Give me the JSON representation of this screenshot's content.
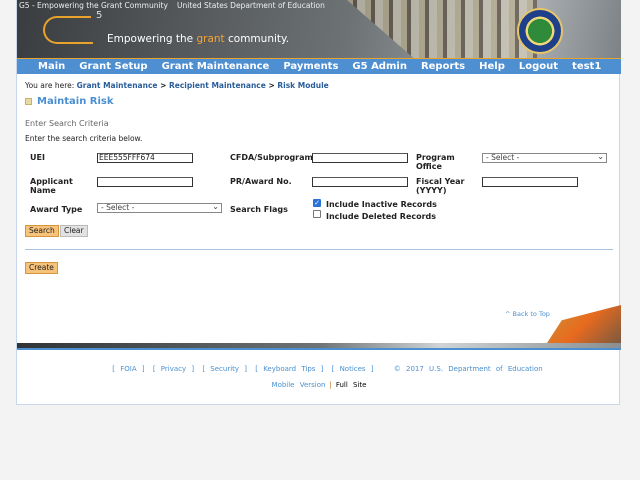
{
  "header": {
    "logo_alt": "G5 - Empowering the Grant Community",
    "seal_alt": "United States Department of Education",
    "logo_mark": "G5",
    "tagline_pre": "Empowering the ",
    "tagline_grant": "grant",
    "tagline_post": " community.",
    "accent": "#e8a32c"
  },
  "nav": {
    "items": [
      "Main",
      "Grant Setup",
      "Grant Maintenance",
      "Payments",
      "G5 Admin",
      "Reports",
      "Help",
      "Logout",
      "test1"
    ],
    "color": "#4e8fd2"
  },
  "breadcrumb": {
    "prefix": "You are here: ",
    "items": [
      "Grant Maintenance",
      "Recipient Maintenance",
      "Risk Module"
    ],
    "sep": " > "
  },
  "page_title": "Maintain Risk",
  "section": "Enter Search Criteria",
  "instructions": "Enter the search criteria below.",
  "form": {
    "uei": {
      "label": "UEI",
      "value": "EEE555FFF674"
    },
    "cfda": {
      "label": "CFDA/Subprogram",
      "value": ""
    },
    "program_office": {
      "label_1": "Program",
      "label_2": "Office",
      "value": "- Select -"
    },
    "applicant": {
      "label_1": "Applicant",
      "label_2": "Name",
      "value": ""
    },
    "pr_award": {
      "label": "PR/Award No.",
      "value": ""
    },
    "fiscal_year": {
      "label_1": "Fiscal Year",
      "label_2": "(YYYY)",
      "value": ""
    },
    "award_type": {
      "label": "Award Type",
      "value": "- Select -"
    },
    "search_flags": {
      "label": "Search Flags",
      "inactive": {
        "label": "Include Inactive Records",
        "checked": true
      },
      "deleted": {
        "label": "Include Deleted Records",
        "checked": false
      }
    }
  },
  "buttons": {
    "search": "Search",
    "clear": "Clear",
    "create": "Create"
  },
  "back_to_top": "^ Back to Top",
  "footer": {
    "links": [
      "[ FOIA ]",
      "[ Privacy ]",
      "[ Security ]",
      "[ Keyboard Tips ]",
      "[ Notices ]"
    ],
    "copyright": "© 2017 U.S. Department of Education",
    "mobile": "Mobile Version",
    "pipe": "|",
    "full": "Full Site"
  }
}
